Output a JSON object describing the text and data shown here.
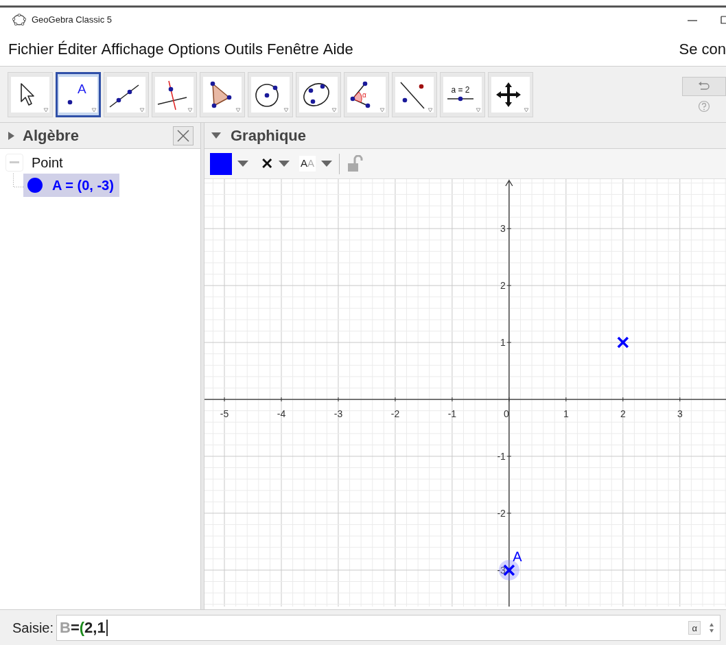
{
  "window": {
    "title": "GeoGebra Classic 5"
  },
  "menu": [
    "Fichier",
    "Éditer",
    "Affichage",
    "Options",
    "Outils",
    "Fenêtre",
    "Aide"
  ],
  "sign_in": "Se con",
  "tools": [
    {
      "kind": "pointer",
      "selected": false
    },
    {
      "kind": "point",
      "label": "A",
      "selected": true
    },
    {
      "kind": "line",
      "selected": false
    },
    {
      "kind": "perpendicular",
      "selected": false
    },
    {
      "kind": "polygon",
      "selected": false
    },
    {
      "kind": "circle",
      "selected": false
    },
    {
      "kind": "conic",
      "selected": false
    },
    {
      "kind": "angle",
      "label": "α",
      "selected": false
    },
    {
      "kind": "reflect",
      "selected": false
    },
    {
      "kind": "slider",
      "label": "a = 2",
      "selected": false
    },
    {
      "kind": "move",
      "selected": false
    }
  ],
  "algebra": {
    "title": "Algèbre",
    "groups": [
      {
        "label": "Point",
        "expanded": true,
        "children": [
          {
            "label": "A = (0, -3)",
            "color": "#0000ff",
            "selected": true
          }
        ]
      }
    ]
  },
  "graphics": {
    "title": "Graphique",
    "style_bar": {
      "color": "#0000ff",
      "point_style": "✕",
      "label_style": "AA"
    },
    "chart_data": {
      "type": "scatter",
      "x": [
        0,
        2
      ],
      "series": [
        {
          "color": "#0000ff",
          "values": [
            -3,
            1
          ]
        }
      ],
      "xlim": [
        -5.35,
        3.81
      ],
      "ylim": [
        -3.64,
        3.87
      ],
      "xticks": [
        -5,
        -4,
        -3,
        -2,
        -1,
        0,
        1,
        2,
        3
      ],
      "yticks": [
        -3,
        -2,
        -1,
        1,
        2,
        3
      ],
      "grid": true,
      "annotations": [
        {
          "text": "A",
          "x": 0,
          "y": -3
        }
      ]
    }
  },
  "input": {
    "label": "Saisie:",
    "value_parts": [
      {
        "text": "B",
        "color": "#a0a0a0"
      },
      {
        "text": "=",
        "color": "#222222"
      },
      {
        "text": "(",
        "color": "#1c8a1c"
      },
      {
        "text": "2,1",
        "color": "#222222"
      }
    ],
    "alpha_button": "α"
  }
}
